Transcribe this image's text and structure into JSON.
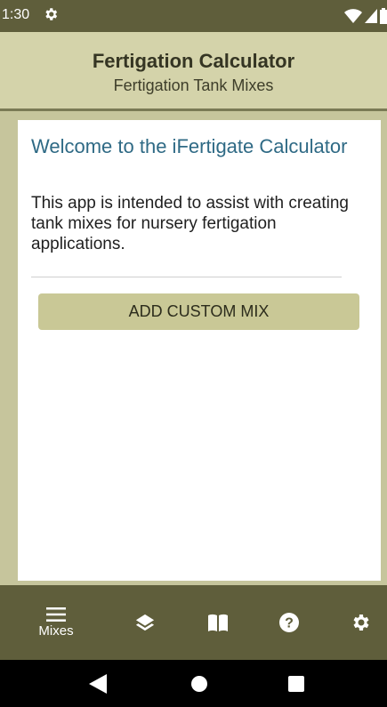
{
  "status_bar": {
    "time": "1:30",
    "icons": [
      "gear-icon",
      "wifi-icon",
      "signal-icon",
      "battery-icon"
    ]
  },
  "header": {
    "title": "Fertigation Calculator",
    "subtitle": "Fertigation Tank Mixes"
  },
  "welcome": {
    "title": "Welcome to the iFertigate Calculator",
    "body": "This app is intended to assist with creating tank mixes for nursery fertigation applications."
  },
  "actions": {
    "add_custom_mix_label": "ADD CUSTOM MIX"
  },
  "bottom_nav": {
    "items": [
      {
        "label": "Mixes",
        "icon": "menu-icon"
      },
      {
        "label": "",
        "icon": "layers-icon"
      },
      {
        "label": "",
        "icon": "book-icon"
      },
      {
        "label": "",
        "icon": "help-icon"
      },
      {
        "label": "",
        "icon": "settings-icon"
      }
    ]
  },
  "system_nav": {
    "buttons": [
      "back-icon",
      "home-icon",
      "recents-icon"
    ]
  },
  "colors": {
    "bar_dark": "#5f5e3b",
    "header_bg": "#d4d3aa",
    "button_bg": "#c9c896",
    "accent_text": "#2f6a85"
  }
}
